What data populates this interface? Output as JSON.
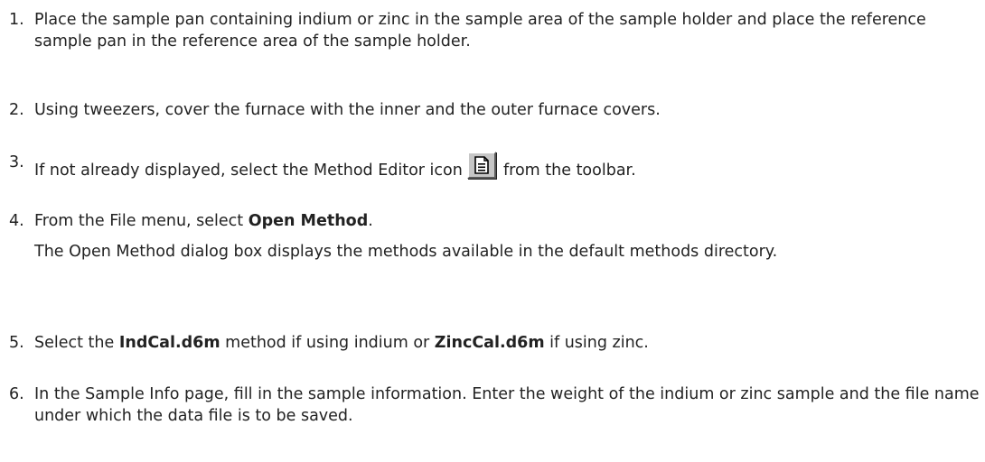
{
  "steps": [
    {
      "number": "1.",
      "text": "Place the sample pan containing indium or zinc in the sample area of the sample holder and place the reference sample pan in the reference area of the sample holder."
    },
    {
      "number": "2.",
      "text": "Using tweezers, cover the furnace with the inner and the outer furnace covers."
    },
    {
      "number": "3.",
      "text_before": "If not already displayed, select the Method Editor icon",
      "icon": "method-editor-icon",
      "text_after": "from the toolbar."
    },
    {
      "number": "4.",
      "text_before": "From the File menu, select ",
      "bold": "Open Method",
      "text_after": ".",
      "note": "The Open Method dialog box displays the methods available in the default methods directory."
    },
    {
      "number": "5.",
      "text_1": "Select the ",
      "bold_1": "IndCal.d6m",
      "text_2": " method if using indium or ",
      "bold_2": "ZincCal.d6m",
      "text_3": " if using zinc."
    },
    {
      "number": "6.",
      "text": "In the Sample Info page, fill in the sample information. Enter the weight of the indium or zinc sample and the file name under which the data file is to be saved."
    }
  ]
}
